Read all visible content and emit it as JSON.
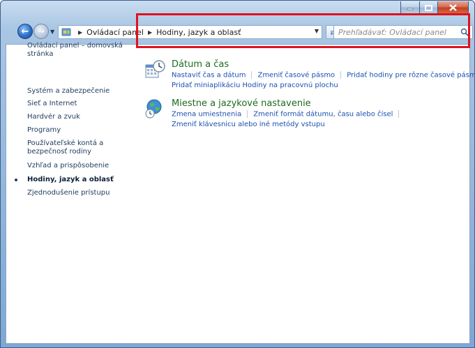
{
  "window": {
    "caption_buttons": [
      "minimize",
      "maximize",
      "close"
    ]
  },
  "nav": {
    "breadcrumb": [
      "Ovládací panel",
      "Hodiny, jazyk a oblasť"
    ],
    "search_placeholder": "Prehľadávať: Ovládací panel"
  },
  "sidebar": {
    "items": [
      {
        "label": "Ovládací panel – domovská stránka"
      },
      {
        "label": "Systém a zabezpečenie"
      },
      {
        "label": "Sieť a Internet"
      },
      {
        "label": "Hardvér a zvuk"
      },
      {
        "label": "Programy"
      },
      {
        "label": "Používateľské kontá a bezpečnosť rodiny"
      },
      {
        "label": "Vzhľad a prispôsobenie"
      },
      {
        "label": "Hodiny, jazyk a oblasť",
        "active": true
      },
      {
        "label": "Zjednodušenie prístupu"
      }
    ]
  },
  "categories": [
    {
      "title": "Dátum a čas",
      "icon": "clock-calendar-icon",
      "links_row1": [
        "Nastaviť čas a dátum",
        "Zmeniť časové pásmo",
        "Pridať hodiny pre rôzne časové pásma"
      ],
      "links_row2": [
        "Pridať miniaplikáciu Hodiny na pracovnú plochu"
      ]
    },
    {
      "title": "Miestne a jazykové nastavenie",
      "icon": "globe-clock-icon",
      "links_row1": [
        "Zmena umiestnenia",
        "Zmeniť formát dátumu, času alebo čísel"
      ],
      "links_row2": [
        "Zmeniť klávesnicu alebo iné metódy vstupu"
      ]
    }
  ],
  "colors": {
    "highlight_border": "#e0121c",
    "category_title": "#1d6b1d",
    "link": "#1a4fb0"
  }
}
